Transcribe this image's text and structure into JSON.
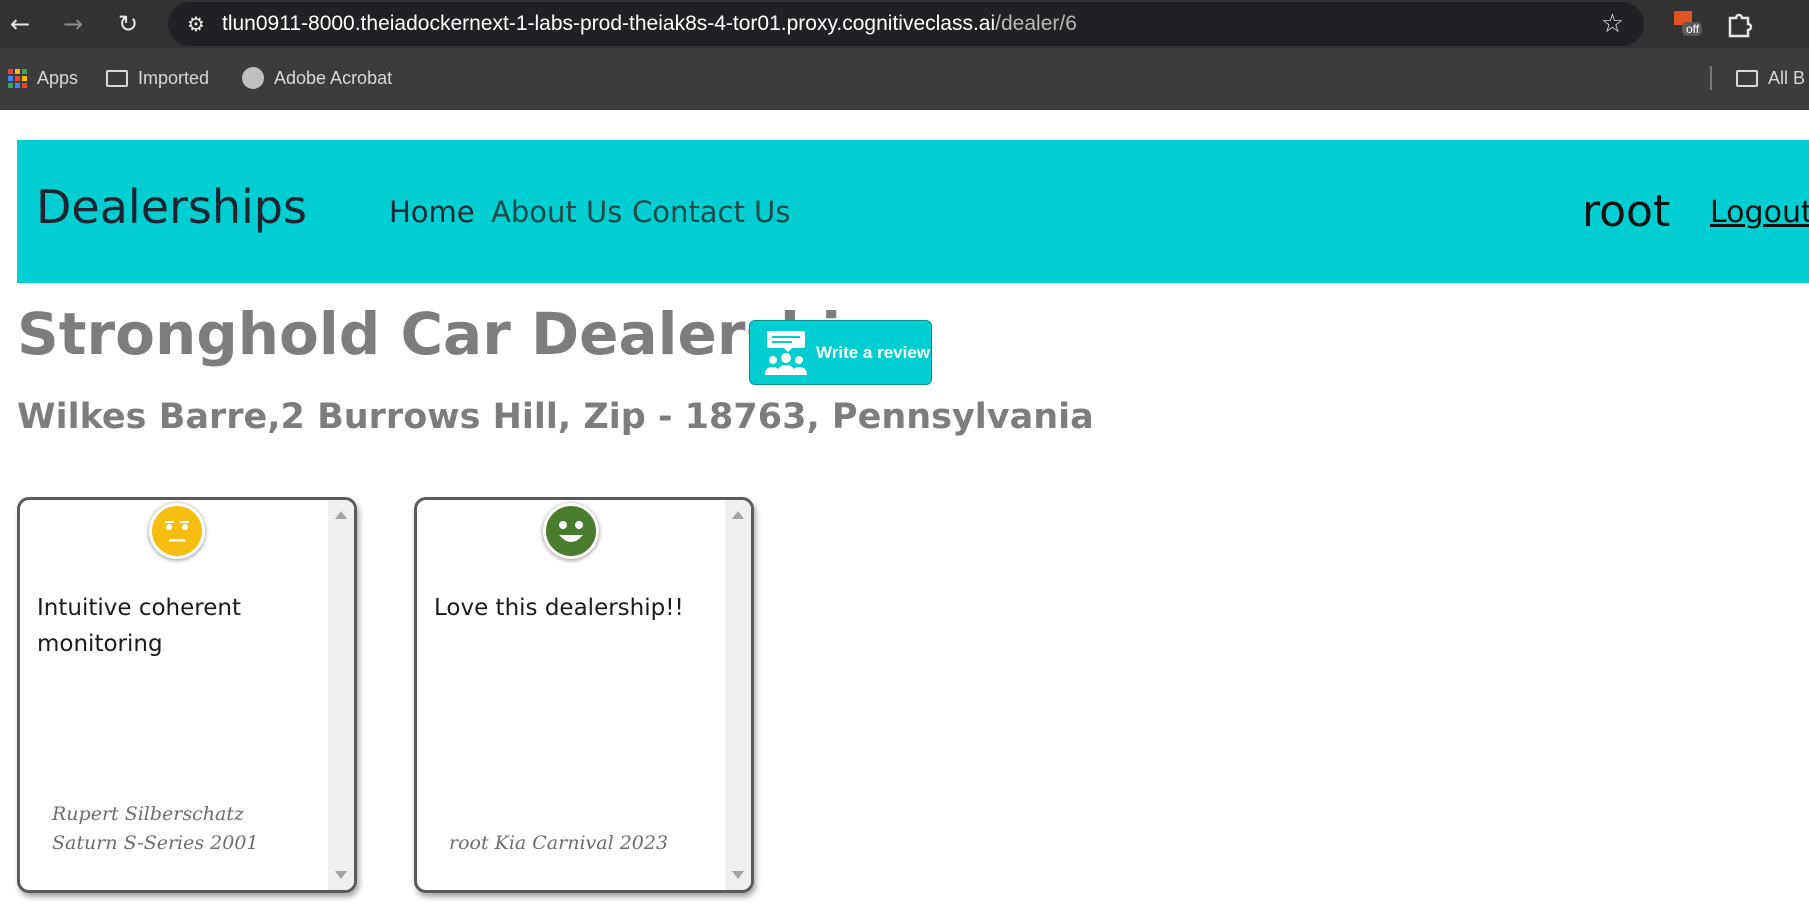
{
  "browser": {
    "url_host": "tlun0911-8000.theiadockernext-1-labs-prod-theiak8s-4-tor01.proxy.cognitiveclass.ai",
    "url_path": "/dealer/6",
    "extension_badge": "off",
    "bookmarks": [
      {
        "label": "Apps",
        "icon": "apps-grid-icon"
      },
      {
        "label": "Imported",
        "icon": "folder-icon"
      },
      {
        "label": "Adobe Acrobat",
        "icon": "globe-icon"
      },
      {
        "label": "All B",
        "icon": "folder-icon"
      }
    ]
  },
  "navbar": {
    "brand": "Dealerships",
    "links": [
      "Home",
      "About Us",
      "Contact Us"
    ],
    "username": "root",
    "logout": "Logout",
    "color": "#00ced1"
  },
  "dealer": {
    "name": "Stronghold Car Dealership",
    "address": "Wilkes Barre,2 Burrows Hill, Zip - 18763, Pennsylvania",
    "review_button_label": "Write a review"
  },
  "reviews": [
    {
      "sentiment": "neutral",
      "face_color": "#f7bd10",
      "text": "Intuitive coherent monitoring",
      "meta": "Rupert Silberschatz Saturn S-Series 2001"
    },
    {
      "sentiment": "positive",
      "face_color": "#4a7c2d",
      "text": "Love this dealership!!",
      "meta": "root Kia Carnival 2023"
    }
  ]
}
